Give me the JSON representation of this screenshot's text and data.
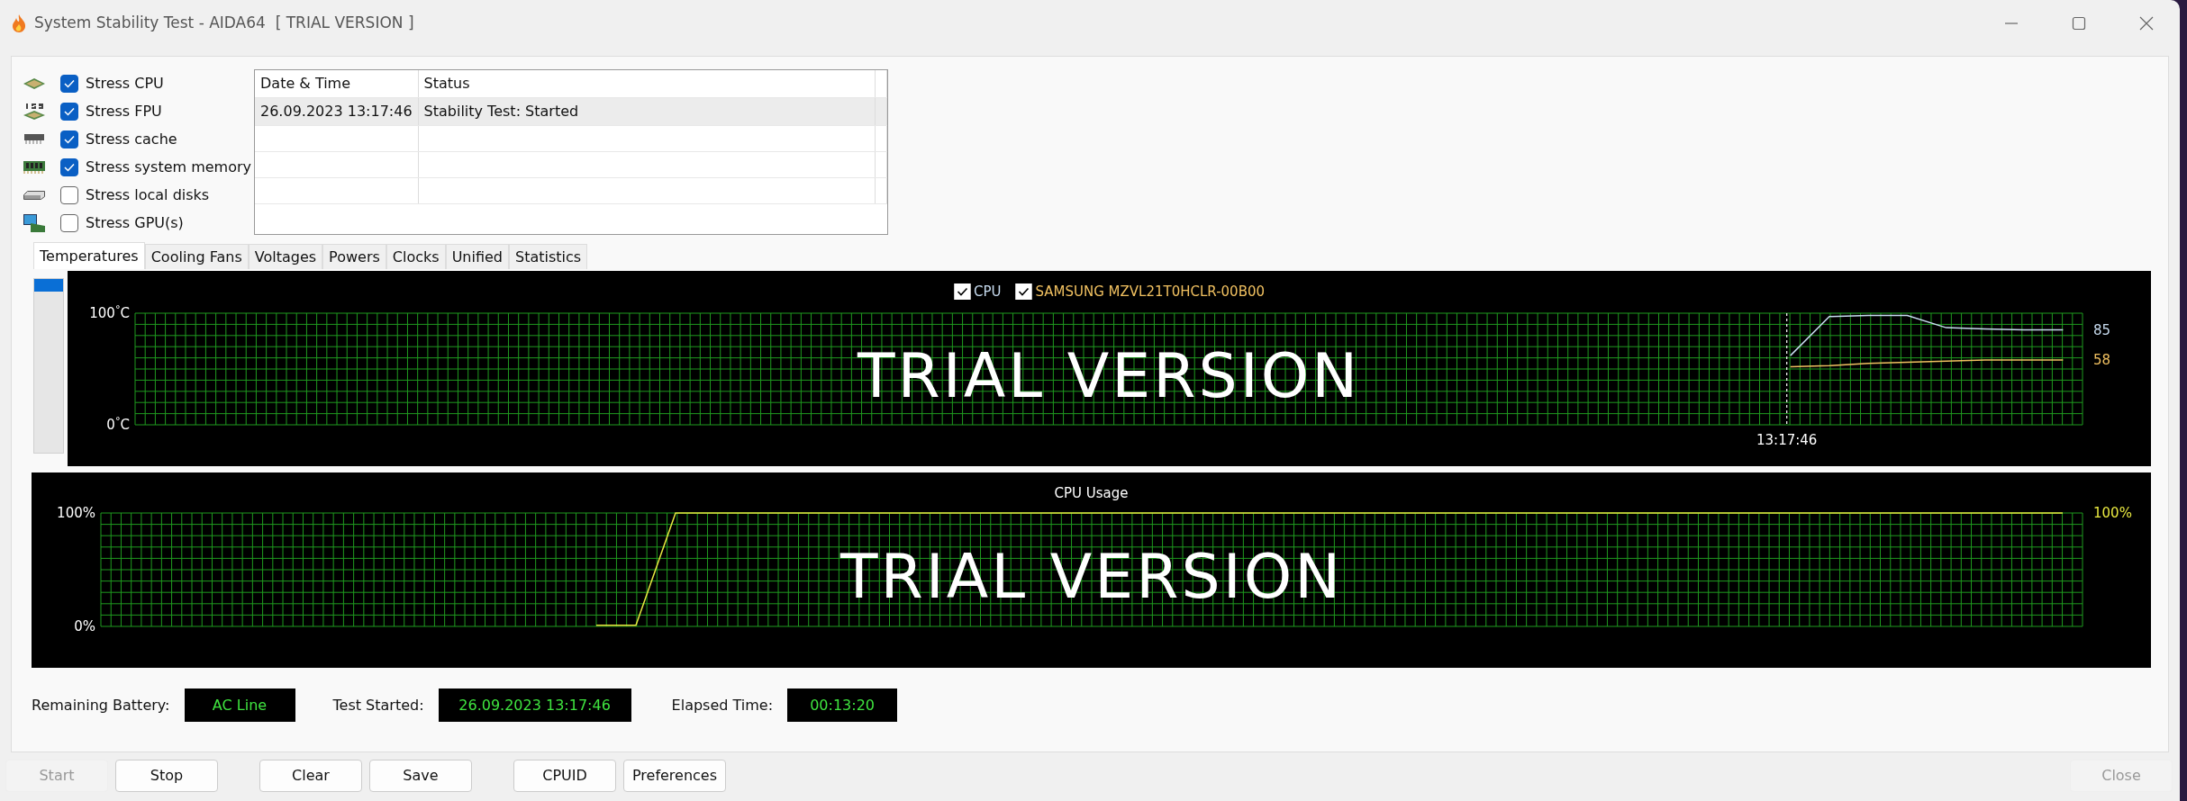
{
  "window": {
    "title": "System Stability Test - AIDA64  [ TRIAL VERSION ]"
  },
  "stress_options": [
    {
      "label": "Stress CPU",
      "checked": true
    },
    {
      "label": "Stress FPU",
      "checked": true
    },
    {
      "label": "Stress cache",
      "checked": true
    },
    {
      "label": "Stress system memory",
      "checked": true
    },
    {
      "label": "Stress local disks",
      "checked": false
    },
    {
      "label": "Stress GPU(s)",
      "checked": false
    }
  ],
  "log_table": {
    "columns": [
      "Date & Time",
      "Status"
    ],
    "rows": [
      {
        "cells": [
          "26.09.2023 13:17:46",
          "Stability Test: Started"
        ],
        "selected": true
      }
    ]
  },
  "tabs": [
    {
      "label": "Temperatures",
      "selected": true
    },
    {
      "label": "Cooling Fans",
      "selected": false
    },
    {
      "label": "Voltages",
      "selected": false
    },
    {
      "label": "Powers",
      "selected": false
    },
    {
      "label": "Clocks",
      "selected": false
    },
    {
      "label": "Unified",
      "selected": false
    },
    {
      "label": "Statistics",
      "selected": false
    }
  ],
  "side_slider": {
    "level": 1
  },
  "temperature_chart": {
    "overlay_text": "TRIAL VERSION",
    "legend": [
      {
        "checked": true
      },
      {
        "checked": true
      }
    ],
    "marker_label": "13:17:46",
    "chart_data": {
      "type": "line",
      "grid": true,
      "categories": [
        null,
        null,
        null,
        null,
        null,
        null,
        null,
        null,
        null,
        null,
        null,
        null,
        null,
        null,
        null,
        null,
        null,
        null,
        null,
        null,
        null,
        null,
        null,
        null,
        null,
        null,
        null,
        null,
        null,
        null,
        null,
        null,
        null,
        null,
        null,
        null,
        null,
        null,
        null,
        null,
        null,
        null,
        null,
        null,
        null,
        null,
        null,
        null,
        null,
        null
      ],
      "ylim": [
        0,
        100
      ],
      "yticks": [
        {
          "value": 0,
          "label": "0$^{°}$C"
        },
        {
          "value": 100,
          "label": "100$^{°}$C"
        }
      ],
      "series": [
        {
          "name": "CPU",
          "color": "#c8dcf0",
          "values": [
            null,
            null,
            null,
            null,
            null,
            null,
            null,
            null,
            null,
            null,
            null,
            null,
            null,
            null,
            null,
            null,
            null,
            null,
            null,
            null,
            null,
            null,
            null,
            null,
            null,
            null,
            null,
            null,
            null,
            null,
            null,
            null,
            null,
            null,
            null,
            null,
            null,
            null,
            null,
            null,
            null,
            null,
            62,
            97,
            98,
            98,
            87,
            86,
            85,
            85
          ]
        },
        {
          "name": "SAMSUNG MZVL21T0HCLR-00B00",
          "color": "#f0c060",
          "values": [
            null,
            null,
            null,
            null,
            null,
            null,
            null,
            null,
            null,
            null,
            null,
            null,
            null,
            null,
            null,
            null,
            null,
            null,
            null,
            null,
            null,
            null,
            null,
            null,
            null,
            null,
            null,
            null,
            null,
            null,
            null,
            null,
            null,
            null,
            null,
            null,
            null,
            null,
            null,
            null,
            null,
            null,
            52,
            53,
            55,
            56,
            57,
            58,
            58,
            58
          ]
        }
      ],
      "annotations": [
        "85",
        "58"
      ]
    }
  },
  "usage_chart": {
    "overlay_text": "TRIAL VERSION",
    "chart_data": {
      "type": "line",
      "title": "CPU Usage",
      "grid": true,
      "categories": [
        null,
        null,
        null,
        null,
        null,
        null,
        null,
        null,
        null,
        null,
        null,
        null,
        null,
        null,
        null,
        null,
        null,
        null,
        null,
        null,
        null,
        null,
        null,
        null,
        null,
        null,
        null,
        null,
        null,
        null,
        null,
        null,
        null,
        null,
        null,
        null,
        null,
        null,
        null,
        null,
        null,
        null,
        null,
        null,
        null,
        null,
        null,
        null,
        null,
        null
      ],
      "ylim": [
        0,
        100
      ],
      "yticks": [
        {
          "value": 0,
          "label": "0%"
        },
        {
          "value": 100,
          "label": "100%"
        }
      ],
      "series": [
        {
          "color": "#e8e840",
          "values": [
            null,
            null,
            null,
            null,
            null,
            null,
            null,
            null,
            null,
            null,
            null,
            null,
            1,
            1,
            100,
            100,
            100,
            100,
            100,
            100,
            100,
            100,
            100,
            100,
            100,
            100,
            100,
            100,
            100,
            100,
            100,
            100,
            100,
            100,
            100,
            100,
            100,
            100,
            100,
            100,
            100,
            100,
            100,
            100,
            100,
            100,
            100,
            100,
            100,
            100
          ]
        }
      ],
      "annotations": [
        "100%"
      ]
    }
  },
  "status_fields": [
    {
      "label": "Remaining Battery:",
      "value": "AC Line"
    },
    {
      "label": "Test Started:",
      "value": "26.09.2023 13:17:46"
    },
    {
      "label": "Elapsed Time:",
      "value": "00:13:20"
    }
  ],
  "button_groups": [
    [
      {
        "label": "Start",
        "disabled": true
      },
      {
        "label": "Stop",
        "disabled": false
      }
    ],
    [
      {
        "label": "Clear",
        "disabled": false
      },
      {
        "label": "Save",
        "disabled": false
      }
    ],
    [
      {
        "label": "CPUID",
        "disabled": false
      },
      {
        "label": "Preferences",
        "disabled": false
      }
    ]
  ],
  "close_button": {
    "label": "Close",
    "disabled": true
  }
}
